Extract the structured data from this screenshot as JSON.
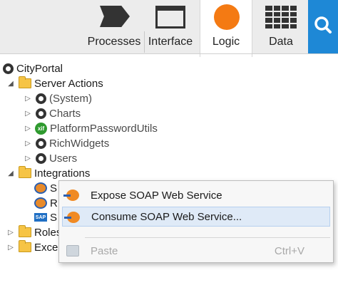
{
  "tabs": [
    {
      "label": "Processes",
      "icon": "process-arrow-icon"
    },
    {
      "label": "Interface",
      "icon": "window-icon"
    },
    {
      "label": "Logic",
      "icon": "orange-circle-icon",
      "active": true
    },
    {
      "label": "Data",
      "icon": "table-grid-icon"
    }
  ],
  "search": {
    "icon": "search-icon",
    "color": "#1e88d6"
  },
  "tree": {
    "root": "CityPortal",
    "server_actions": "Server Actions",
    "items": [
      "(System)",
      "Charts",
      "PlatformPasswordUtils",
      "RichWidgets",
      "Users"
    ],
    "xif_badge": "xif",
    "integrations": "Integrations",
    "integration_items": [
      "S",
      "R",
      "S"
    ],
    "sap_badge": "SAP",
    "roles": "Roles",
    "exceptions": "Exce"
  },
  "context_menu": {
    "items": [
      {
        "label": "Expose SOAP Web Service",
        "icon": "expose-soap-icon"
      },
      {
        "label": "Consume SOAP Web Service...",
        "icon": "consume-soap-icon",
        "highlighted": true
      },
      {
        "label": "Paste",
        "shortcut": "Ctrl+V",
        "icon": "paste-icon",
        "disabled": true
      }
    ]
  },
  "colors": {
    "accent": "#1e88d6",
    "logic": "#f47a13",
    "folder": "#f6c445"
  }
}
